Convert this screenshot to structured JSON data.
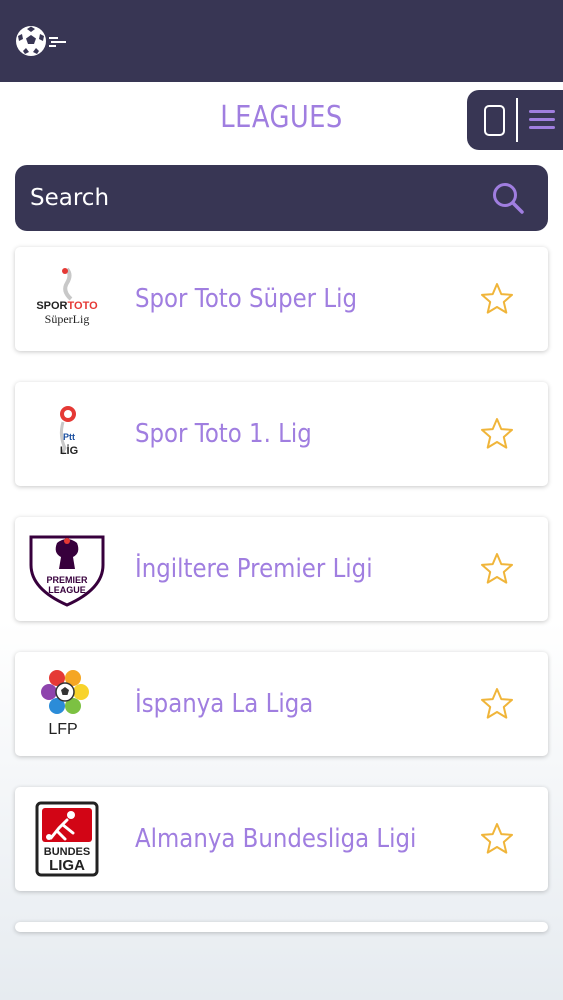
{
  "header": {
    "logo_icon": "soccer-ball-speed-icon"
  },
  "page": {
    "title": "LEAGUES"
  },
  "view_toggle": {
    "icons": [
      "phone-icon",
      "menu-icon"
    ]
  },
  "search": {
    "placeholder": "Search",
    "value": "",
    "icon": "search-icon"
  },
  "leagues": [
    {
      "name": "Spor Toto Süper Lig",
      "logo_text": "SPORTOTO SüperLig",
      "favorite": false
    },
    {
      "name": "Spor Toto 1. Lig",
      "logo_text": "Ptt LİG",
      "favorite": false
    },
    {
      "name": "İngiltere Premier Ligi",
      "logo_text": "PREMIER LEAGUE",
      "favorite": false
    },
    {
      "name": "İspanya La Liga",
      "logo_text": "LFP",
      "favorite": false
    },
    {
      "name": "Almanya Bundesliga Ligi",
      "logo_text": "BUNDES LIGA",
      "favorite": false
    }
  ],
  "colors": {
    "header_bg": "#383654",
    "accent": "#a07ee0",
    "star": "#f0b53a"
  }
}
